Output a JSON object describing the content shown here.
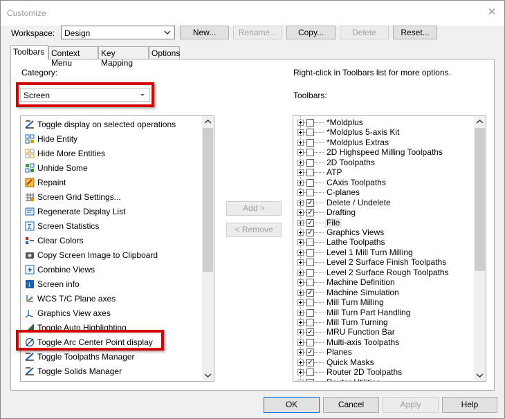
{
  "window": {
    "title": "Customize"
  },
  "workspace": {
    "label": "Workspace:",
    "value": "Design"
  },
  "top_buttons": {
    "new": "New...",
    "rename": "Rename...",
    "copy": "Copy...",
    "delete": "Delete",
    "reset": "Reset..."
  },
  "tabs": [
    "Toolbars",
    "Context Menu",
    "Key Mapping",
    "Options"
  ],
  "left": {
    "category_label": "Category:",
    "category_value": "Screen",
    "commands": [
      "Toggle display on selected operations",
      "Hide Entity",
      "Hide More Entities",
      "Unhide Some",
      "Repaint",
      "Screen Grid Settings...",
      "Regenerate Display List",
      "Screen Statistics",
      "Clear Colors",
      "Copy Screen Image to Clipboard",
      "Combine Views",
      "Screen info",
      "WCS  T/C Plane axes",
      "Graphics View axes",
      "Toggle Auto Highlighting",
      "Toggle Arc Center Point display",
      "Toggle Toolpaths Manager",
      "Toggle Solids Manager"
    ]
  },
  "middle": {
    "add": "Add >",
    "remove": "< Remove"
  },
  "right": {
    "hint": "Right-click in Toolbars list for more options.",
    "toolbars_label": "Toolbars:",
    "toolbars": [
      {
        "name": "*Moldplus",
        "checked": false
      },
      {
        "name": "*Moldplus 5-axis Kit",
        "checked": false
      },
      {
        "name": "*Moldplus Extras",
        "checked": false
      },
      {
        "name": "2D Highspeed Milling Toolpaths",
        "checked": false
      },
      {
        "name": "2D Toolpaths",
        "checked": false
      },
      {
        "name": "ATP",
        "checked": false
      },
      {
        "name": "CAxis Toolpaths",
        "checked": false
      },
      {
        "name": "C-planes",
        "checked": false
      },
      {
        "name": "Delete / Undelete",
        "checked": true
      },
      {
        "name": "Drafting",
        "checked": true
      },
      {
        "name": "File",
        "checked": true
      },
      {
        "name": "Graphics Views",
        "checked": true
      },
      {
        "name": "Lathe Toolpaths",
        "checked": false
      },
      {
        "name": "Level 1 Mill Turn Milling",
        "checked": false
      },
      {
        "name": "Level 2 Surface Finish Toolpaths",
        "checked": false
      },
      {
        "name": "Level 2 Surface Rough Toolpaths",
        "checked": false
      },
      {
        "name": "Machine Definition",
        "checked": false
      },
      {
        "name": "Machine Simulation",
        "checked": true
      },
      {
        "name": "Mill Turn Milling",
        "checked": false
      },
      {
        "name": "Mill Turn Part Handling",
        "checked": false
      },
      {
        "name": "Mill Turn Turning",
        "checked": false
      },
      {
        "name": "MRU Function Bar",
        "checked": true
      },
      {
        "name": "Multi-axis Toolpaths",
        "checked": false
      },
      {
        "name": "Planes",
        "checked": true
      },
      {
        "name": "Quick Masks",
        "checked": true
      },
      {
        "name": "Router 2D Toolpaths",
        "checked": false
      },
      {
        "name": "Router Utilities",
        "checked": false
      }
    ]
  },
  "bottom": {
    "ok": "OK",
    "cancel": "Cancel",
    "apply": "Apply",
    "help": "Help"
  }
}
